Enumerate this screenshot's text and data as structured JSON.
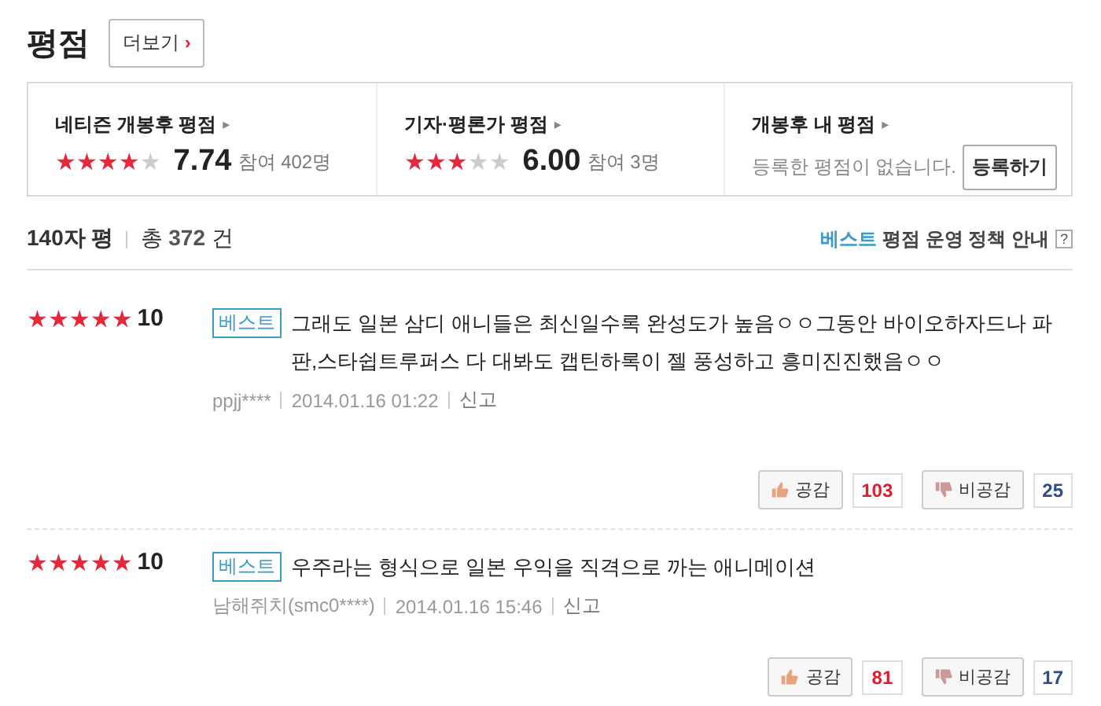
{
  "header": {
    "title": "평점",
    "more_button": "더보기",
    "more_caret": "›"
  },
  "summary": [
    {
      "kind": "score",
      "label": "네티즌 개봉후 평점",
      "arrow": "▸",
      "stars": 4,
      "score": "7.74",
      "participants": "참여 402명"
    },
    {
      "kind": "score",
      "label": "기자·평론가 평점",
      "arrow": "▸",
      "stars": 3,
      "score": "6.00",
      "participants": "참여 3명"
    },
    {
      "kind": "mine",
      "label": "개봉후 내 평점",
      "arrow": "▸",
      "message": "등록한 평점이 없습니다.",
      "button": "등록하기"
    }
  ],
  "list_header": {
    "title": "140자 평",
    "total_prefix": "총",
    "total": "372",
    "total_suffix": "건",
    "policy_highlight": "베스트",
    "policy": "평점 운영 정책 안내",
    "help": "?"
  },
  "reviews": [
    {
      "stars": 5,
      "score": "10",
      "badge": "베스트",
      "text": "그래도 일본 삼디 애니들은 최신일수록 완성도가 높음ㅇㅇ그동안 바이오하자드나 파판,스타쉽트루퍼스 다 대봐도 캡틴하록이 젤 풍성하고 흥미진진했음ㅇㅇ",
      "author": "ppjj****",
      "date": "2014.01.16 01:22",
      "report": "신고",
      "like": "공감",
      "like_count": "103",
      "dislike": "비공감",
      "dislike_count": "25"
    },
    {
      "stars": 5,
      "score": "10",
      "badge": "베스트",
      "text": "우주라는 형식으로 일본 우익을 직격으로 까는 애니메이션",
      "author": "남해쥐치(smc0****)",
      "date": "2014.01.16 15:46",
      "report": "신고",
      "like": "공감",
      "like_count": "81",
      "dislike": "비공감",
      "dislike_count": "17"
    }
  ]
}
